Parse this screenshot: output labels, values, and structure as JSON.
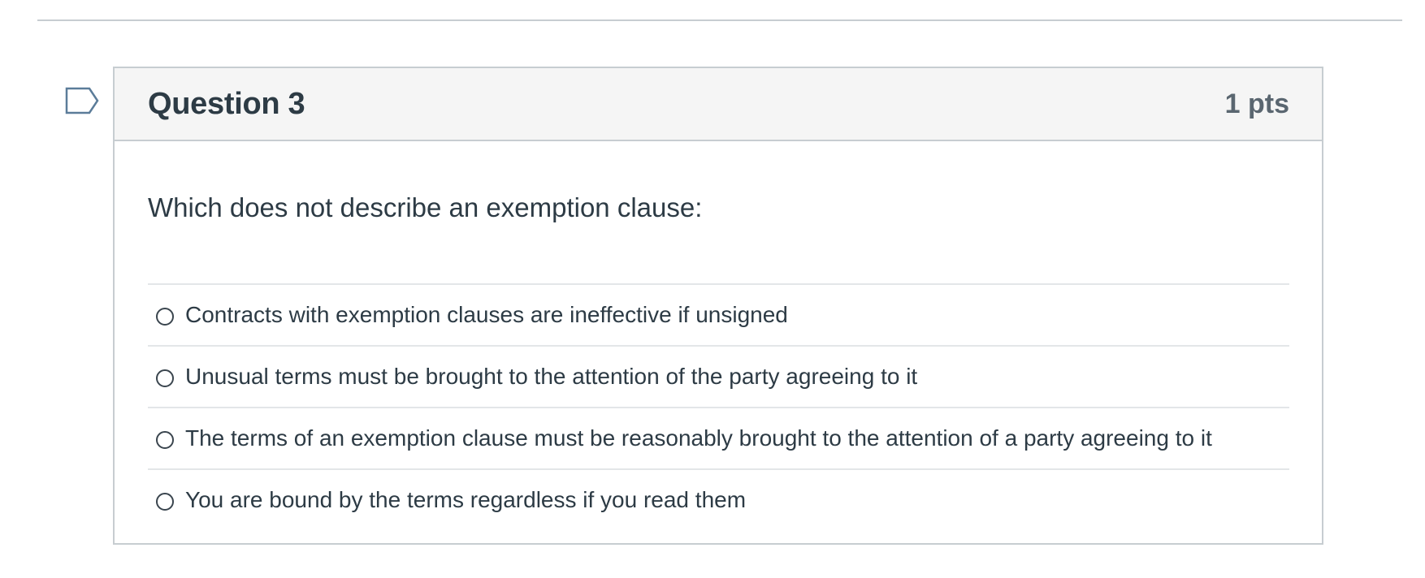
{
  "question": {
    "title": "Question 3",
    "points": "1 pts",
    "text": "Which does not describe an exemption clause:",
    "flag_icon": "flag-question-icon",
    "answers": [
      {
        "label": "Contracts with exemption clauses are ineffective if unsigned",
        "selected": false
      },
      {
        "label": "Unusual terms must be brought to the attention of the party agreeing to it",
        "selected": false
      },
      {
        "label": "The terms of an exemption clause must be reasonably brought to the attention of a party agreeing to it",
        "selected": false
      },
      {
        "label": "You are bound by the terms regardless if you read them",
        "selected": false
      }
    ]
  },
  "colors": {
    "text": "#2d3b45",
    "border": "#c7cdd1",
    "header_bg": "#f5f5f5",
    "flag": "#5b7c99",
    "points": "#5a6670"
  }
}
